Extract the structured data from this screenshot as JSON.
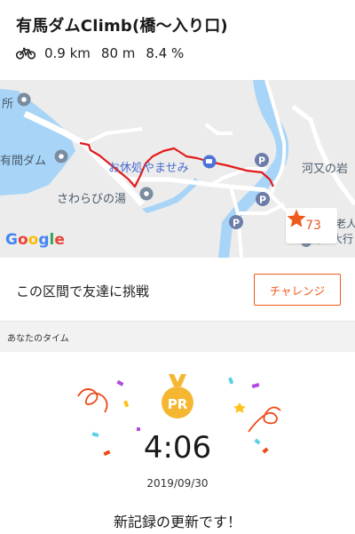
{
  "segment": {
    "title": "有馬ダムClimb(橋〜入り口)",
    "distance": "0.9 km",
    "elevation": "80 m",
    "grade": "8.4 %",
    "activity_icon": "bike-icon"
  },
  "map": {
    "labels": {
      "sho": "所",
      "dam": "有間ダム",
      "cafe": "お休処やませみ",
      "spa": "さわらびの湯",
      "kawamata": "河又の岩",
      "facility1": "老人",
      "facility2": "施設大行"
    },
    "attribution": "Google",
    "attribution_colors": [
      "#4285F4",
      "#EA4335",
      "#FBBC05",
      "#4285F4",
      "#34A853",
      "#EA4335"
    ],
    "star_count": "73",
    "route_color": "#e31b1b"
  },
  "challenge": {
    "text": "この区間で友達に挑戦",
    "button_label": "チャレンジ"
  },
  "your_time": {
    "section_label": "あなたのタイム",
    "badge": "PR",
    "time": "4:06",
    "date": "2019/09/30",
    "message": "新記録の更新です！"
  },
  "colors": {
    "accent": "#f05a1a",
    "medal": "#f5b731",
    "water": "#a8d5f7"
  }
}
